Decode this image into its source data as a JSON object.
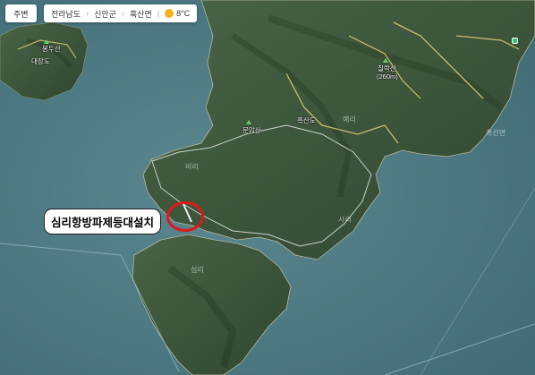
{
  "toolbar": {
    "nearby_label": "주변",
    "breadcrumbs": [
      "전라남도",
      "신안군",
      "흑산면"
    ],
    "weather": {
      "icon": "partly-sunny-icon",
      "temperature": "8°C"
    }
  },
  "places": {
    "peak_west": "봉두산",
    "village_west": "대장도",
    "peak_north": "칠락산",
    "peak_north_elev": "(260m)",
    "port": "흑산도",
    "peak_center": "문암산",
    "village_east": "예리",
    "village_far_east": "흑산면",
    "village_south_west": "심리",
    "village_south": "사리",
    "village_center": "비리"
  },
  "annotation": {
    "label": "심리항방파제등대설치"
  },
  "colors": {
    "sea": "#4f7b84",
    "land": "#3f5a3a",
    "road": "#c9c06a",
    "annotation_circle": "#e01818"
  }
}
